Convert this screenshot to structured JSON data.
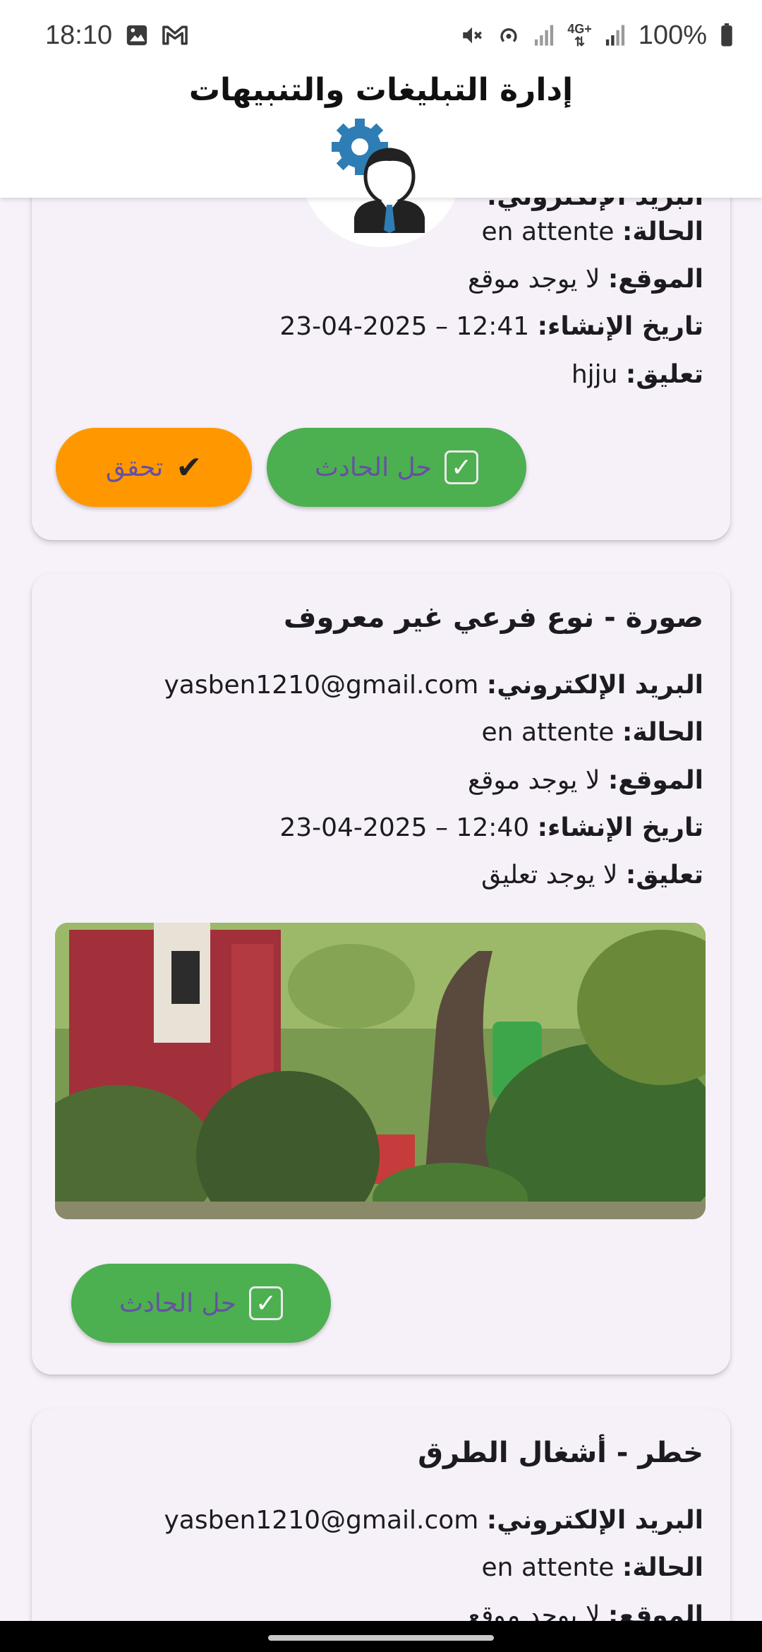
{
  "status_bar": {
    "time": "18:10",
    "battery_percent": "100%",
    "network": "4G+",
    "icons": [
      "gallery-icon",
      "gmail-icon",
      "mute-icon",
      "hotspot-icon",
      "signal-icon",
      "data-icon",
      "signal-icon",
      "battery-icon"
    ]
  },
  "app_bar": {
    "title": "إدارة التبليغات والتنبيهات",
    "avatar_icon": "admin-settings-icon"
  },
  "cards": [
    {
      "email_label": "البريد الإلكتروني:",
      "status_label": "الحالة:",
      "status_value": "en attente",
      "location_label": "الموقع:",
      "location_value": "لا يوجد موقع",
      "created_label": "تاريخ الإنشاء:",
      "created_value": "23-04-2025 – 12:41",
      "comment_label": "تعليق:",
      "comment_value": "hjju",
      "resolve_label": "حل الحادث",
      "verify_label": "تحقق"
    },
    {
      "title": "صورة - نوع فرعي غير معروف",
      "email_label": "البريد الإلكتروني:",
      "email_value": "yasben1210@gmail.com",
      "status_label": "الحالة:",
      "status_value": "en attente",
      "location_label": "الموقع:",
      "location_value": "لا يوجد موقع",
      "created_label": "تاريخ الإنشاء:",
      "created_value": "23-04-2025 – 12:40",
      "comment_label": "تعليق:",
      "comment_value": "لا يوجد تعليق",
      "resolve_label": "حل الحادث"
    },
    {
      "title": "خطر - أشغال الطرق",
      "email_label": "البريد الإلكتروني:",
      "email_value": "yasben1210@gmail.com",
      "status_label": "الحالة:",
      "status_value": "en attente",
      "location_label": "الموقع:",
      "location_value": "لا يوجد موقع"
    }
  ],
  "colors": {
    "resolve_button": "#4caf50",
    "verify_button": "#ff9800",
    "button_text": "#6650a4",
    "background": "#f7f2fa"
  }
}
